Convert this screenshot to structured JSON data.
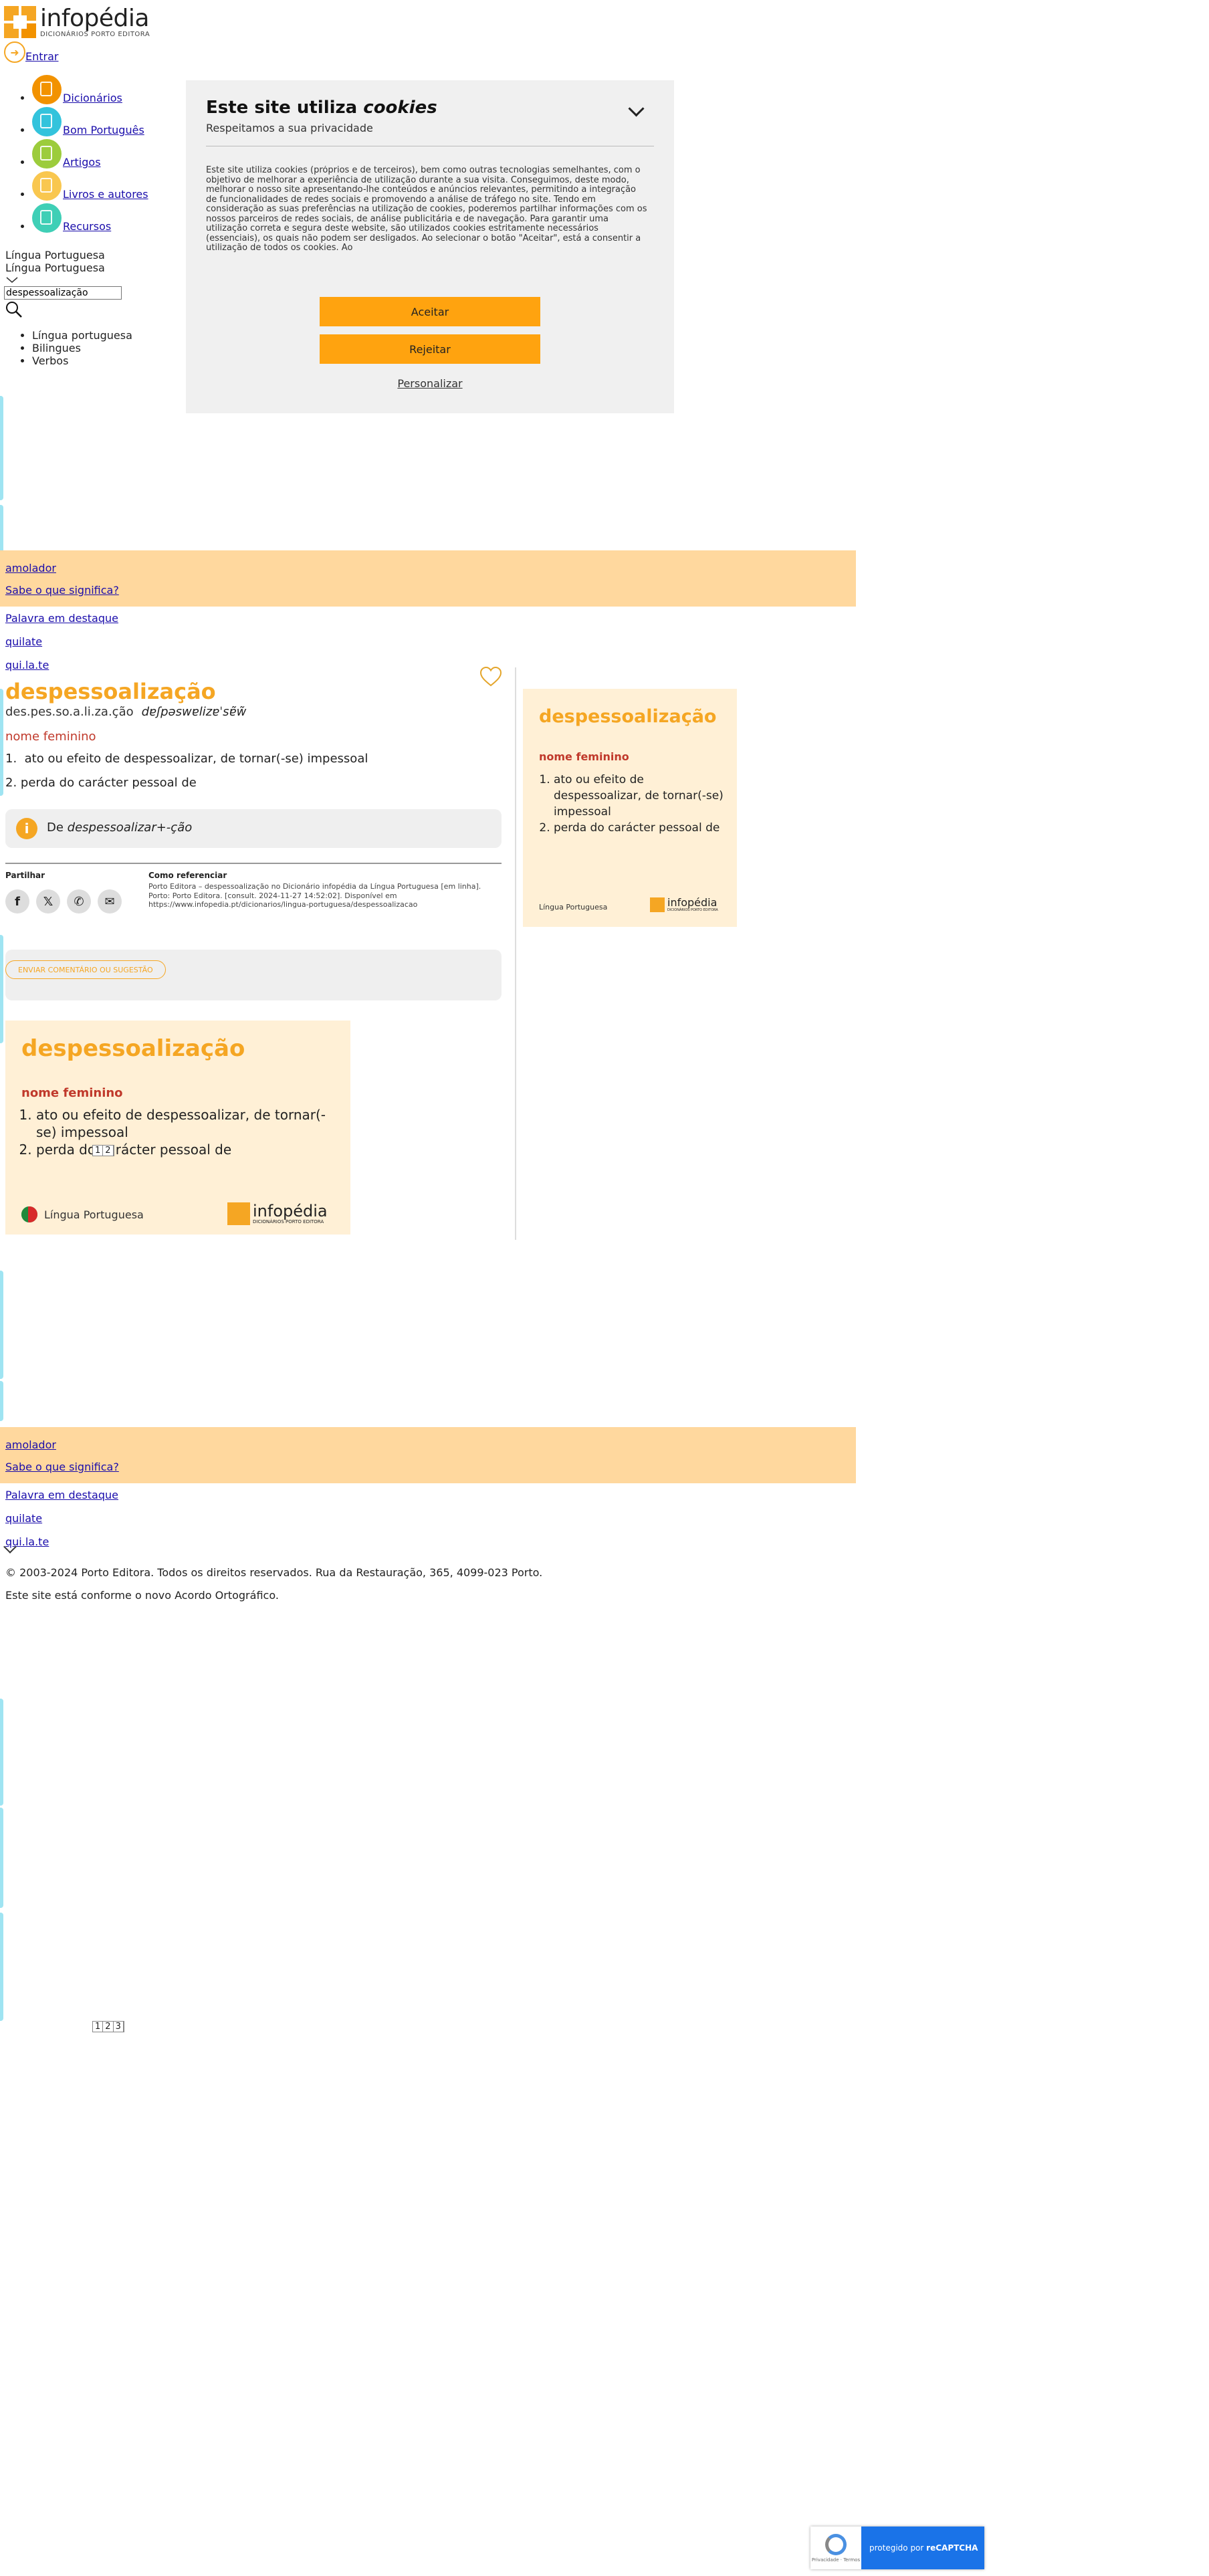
{
  "header": {
    "logo_name": "infopédia",
    "logo_sub": "DICIONÁRIOS PORTO EDITORA",
    "login": "Entrar"
  },
  "nav": [
    {
      "label": "Dicionários",
      "color": "#f29200"
    },
    {
      "label": "Bom Português",
      "color": "#33c3dc"
    },
    {
      "label": "Artigos",
      "color": "#9ccc3c"
    },
    {
      "label": "Livros e autores",
      "color": "#f9c74f"
    },
    {
      "label": "Recursos",
      "color": "#3fcfb6"
    }
  ],
  "language": {
    "selected": "Língua Portuguesa",
    "current": "Língua Portuguesa"
  },
  "search": {
    "value": "despessoalização"
  },
  "sublang": [
    "Língua portuguesa",
    "Bilingues",
    "Verbos"
  ],
  "cookie": {
    "title": "Este site utiliza",
    "title_em": "cookies",
    "subtitle": "Respeitamos a sua privacidade",
    "body": "Este site utiliza cookies (próprios e de terceiros), bem como outras tecnologias semelhantes, com o objetivo de melhorar a experiência de utilização durante a sua visita. Conseguimos, deste modo, melhorar o nosso site apresentando-lhe conteúdos e anúncios relevantes, permitindo a integração de funcionalidades de redes sociais e promovendo a análise de tráfego no site. Tendo em consideração as suas preferências na utilização de cookies, poderemos partilhar informações com os nossos parceiros de redes sociais, de análise publicitária e de navegação. Para garantir uma utilização correta e segura deste website, são utilizados cookies estritamente necessários (essenciais), os quais não podem ser desligados. Ao selecionar o botão \"Aceitar\", está a consentir a utilização de todos os cookies. Ao",
    "accept": "Aceitar",
    "reject": "Rejeitar",
    "customize": "Personalizar"
  },
  "word_of_day": {
    "word": "amolador",
    "know_meaning": "Sabe o que significa?",
    "featured": "Palavra em destaque",
    "featured_word": "quilate",
    "featured_syll": "qui.la.te"
  },
  "entry": {
    "headword": "despessoalização",
    "syllables": "des.pes.so.a.li.za.ção",
    "ipa": "dɐʃpəswɐlizɐˈsɐ̃w̃",
    "grammar": "nome feminino",
    "senses": [
      "ato ou efeito de despessoalizar, de tornar(-se) impessoal",
      "perda do carácter pessoal de"
    ],
    "etymology_prefix": "De",
    "etymology_em": "despessoalizar+-ção",
    "share_heading": "Partilhar",
    "ref_heading": "Como referenciar",
    "ref_text": "Porto Editora – despessoalização no Dicionário infopédia da Língua Portuguesa [em linha]. Porto: Porto Editora. [consult. 2024-11-27 14:52:02]. Disponível em https://www.infopedia.pt/dicionarios/lingua-portuguesa/despessoalizacao",
    "comment_button": "ENVIAR COMENTÁRIO OU SUGESTÃO"
  },
  "card": {
    "word": "despessoalização",
    "grammar": "nome feminino",
    "senses": [
      "ato ou efeito de despessoalizar, de tornar(-se) impessoal",
      "perda do carácter pessoal de"
    ],
    "language": "Língua Portuguesa",
    "logo": "infopédia",
    "logo_sub": "DICIONÁRIOS PORTO EDITORA"
  },
  "pager": {
    "p1": "1",
    "p2": "2",
    "p3": "3"
  },
  "footer": {
    "copyright": "© 2003-2024 Porto Editora. Todos os direitos reservados. Rua da Restauração, 365, 4099-023 Porto.",
    "agreement": "Este site está conforme o novo Acordo Ortográfico."
  },
  "recaptcha": {
    "text": "protegido por",
    "brand": "reCAPTCHA",
    "small": "Privacidade · Termos"
  }
}
